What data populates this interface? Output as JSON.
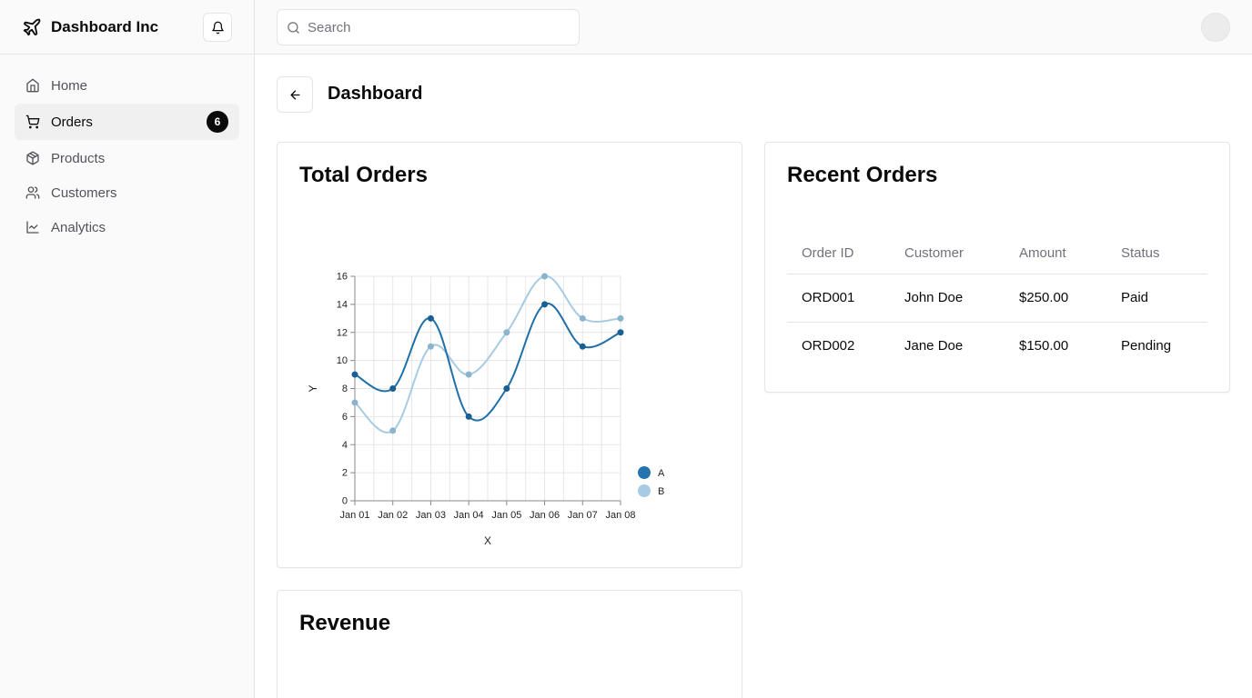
{
  "brand": {
    "name": "Dashboard Inc",
    "icon": "airplane-icon"
  },
  "sidebar": {
    "items": [
      {
        "label": "Home",
        "icon": "home-icon"
      },
      {
        "label": "Orders",
        "icon": "cart-icon",
        "badge": "6",
        "active": true
      },
      {
        "label": "Products",
        "icon": "package-icon"
      },
      {
        "label": "Customers",
        "icon": "users-icon"
      },
      {
        "label": "Analytics",
        "icon": "line-chart-icon"
      }
    ]
  },
  "search": {
    "placeholder": "Search",
    "value": ""
  },
  "page": {
    "title": "Dashboard"
  },
  "total_orders": {
    "title": "Total Orders"
  },
  "revenue": {
    "title": "Revenue"
  },
  "recent_orders": {
    "title": "Recent Orders",
    "columns": [
      "Order ID",
      "Customer",
      "Amount",
      "Status"
    ],
    "rows": [
      [
        "ORD001",
        "John Doe",
        "$250.00",
        "Paid"
      ],
      [
        "ORD002",
        "Jane Doe",
        "$150.00",
        "Pending"
      ]
    ]
  },
  "colors": {
    "series_a": "#1f6fa8",
    "series_b": "#a6cbe3",
    "accent": "#0a0a0a"
  },
  "chart_data": {
    "type": "line",
    "title": "Total Orders",
    "xlabel": "X",
    "ylabel": "Y",
    "categories": [
      "Jan 01",
      "Jan 02",
      "Jan 03",
      "Jan 04",
      "Jan 05",
      "Jan 06",
      "Jan 07",
      "Jan 08"
    ],
    "series": [
      {
        "name": "A",
        "values": [
          9,
          8,
          13,
          6,
          8,
          14,
          11,
          12
        ]
      },
      {
        "name": "B",
        "values": [
          7,
          5,
          11,
          9,
          12,
          16,
          13,
          13
        ]
      }
    ],
    "yticks": [
      0,
      2,
      4,
      6,
      8,
      10,
      12,
      14,
      16
    ],
    "ylim": [
      0,
      16
    ],
    "grid": true,
    "legend": "right"
  }
}
